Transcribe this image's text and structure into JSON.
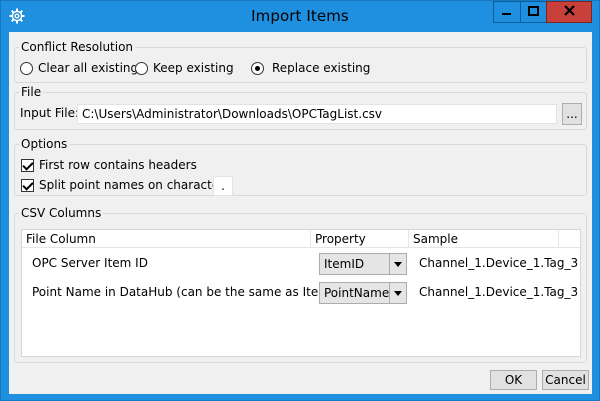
{
  "window": {
    "title": "Import Items"
  },
  "conflict": {
    "legend": "Conflict Resolution",
    "options": [
      {
        "label": "Clear all existing",
        "selected": false
      },
      {
        "label": "Keep existing",
        "selected": false
      },
      {
        "label": "Replace existing",
        "selected": true
      }
    ]
  },
  "file": {
    "legend": "File",
    "input_label": "Input File:",
    "input_value": "C:\\Users\\Administrator\\Downloads\\OPCTagList.csv",
    "browse_label": "..."
  },
  "options": {
    "legend": "Options",
    "first_row_headers": {
      "label": "First row contains headers",
      "checked": true
    },
    "split_names": {
      "label": "Split point names on character:",
      "checked": true,
      "value": "."
    }
  },
  "csv": {
    "legend": "CSV Columns",
    "headers": {
      "file_column": "File Column",
      "property": "Property",
      "sample": "Sample"
    },
    "rows": [
      {
        "file_column": "OPC Server Item ID",
        "property": "ItemID",
        "sample": "Channel_1.Device_1.Tag_3"
      },
      {
        "file_column": "Point Name in DataHub (can be the same as ItemID)",
        "property": "PointName",
        "sample": "Channel_1.Device_1.Tag_3"
      }
    ]
  },
  "footer": {
    "ok_label": "OK",
    "cancel_label": "Cancel"
  },
  "icons": {
    "app": "gear-icon",
    "minimize": "minimize-icon",
    "maximize": "maximize-icon",
    "close": "close-icon"
  }
}
